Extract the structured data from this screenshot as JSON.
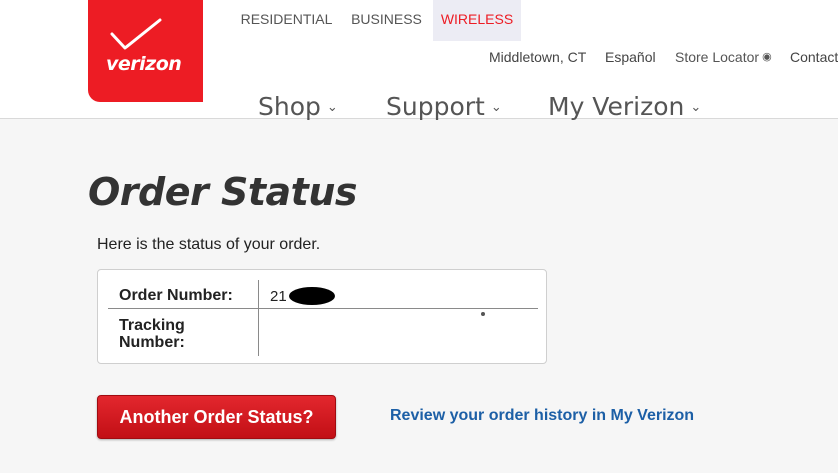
{
  "brand": {
    "logo_text": "verizon",
    "logo_color": "#ed1c24"
  },
  "segments": [
    {
      "label": "RESIDENTIAL",
      "active": false
    },
    {
      "label": "BUSINESS",
      "active": false
    },
    {
      "label": "WIRELESS",
      "active": true
    }
  ],
  "utility": {
    "location": "Middletown, CT",
    "language": "Español",
    "store_locator": "Store Locator",
    "store_icon": "map-pin-icon",
    "contact": "Contact"
  },
  "main_nav": [
    {
      "label": "Shop",
      "icon": "chevron-down-icon"
    },
    {
      "label": "Support",
      "icon": "chevron-down-icon"
    },
    {
      "label": "My Verizon",
      "icon": "chevron-down-icon"
    }
  ],
  "page": {
    "title": "Order Status",
    "intro": "Here is the status of your order."
  },
  "status_table": {
    "order_number_label": "Order Number:",
    "order_number_value": "21",
    "tracking_number_label": "Tracking Number:",
    "tracking_number_value": ""
  },
  "actions": {
    "another_button": "Another Order Status?",
    "history_link": "Review your order history in My Verizon"
  },
  "colors": {
    "accent_red": "#ed1c24",
    "link_blue": "#1c5fa6",
    "active_segment_bg": "#ececf4"
  }
}
